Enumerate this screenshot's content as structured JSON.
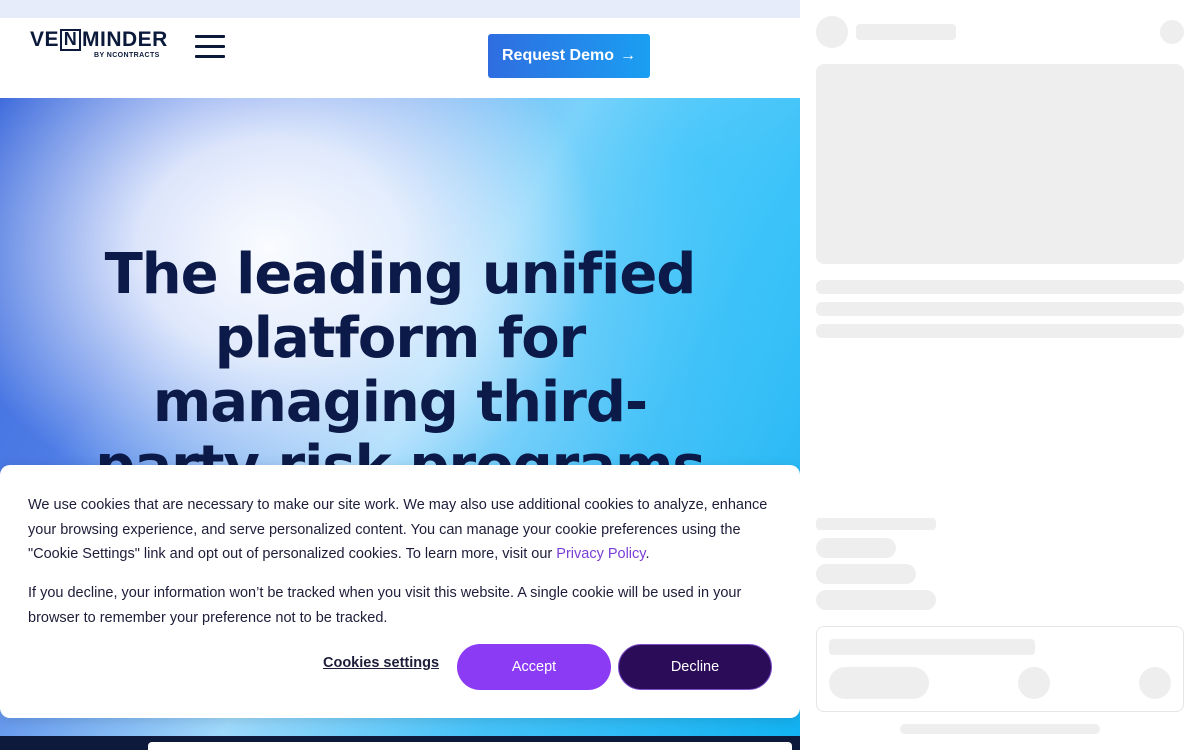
{
  "brand": {
    "logo_prefix": "VE",
    "logo_boxed_letter": "N",
    "logo_suffix": "MINDER",
    "logo_byline": "BY NCONTRACTS"
  },
  "header": {
    "menu_icon": "hamburger-menu-icon",
    "demo_label": "Request Demo",
    "demo_arrow": "→"
  },
  "hero": {
    "title": "The leading unified platform for managing third-party risk programs"
  },
  "cookie_banner": {
    "paragraph1_text": "We use cookies that are necessary to make our site work. We may also use additional cookies to analyze, enhance your browsing experience, and serve personalized content. You can manage your cookie preferences using the \"Cookie Settings\" link and opt out of personalized cookies. To learn more, visit our ",
    "privacy_link": "Privacy Policy",
    "paragraph1_end": ".",
    "paragraph2": "If you decline, your information won’t be tracked when you visit this website. A single cookie will be used in your browser to remember your preference not to be tracked.",
    "settings_label": "Cookies settings",
    "accept_label": "Accept",
    "decline_label": "Decline"
  },
  "colors": {
    "brand_navy": "#0b1a3b",
    "accept_purple": "#8c3bf4",
    "decline_purple": "#2a0c58",
    "link_purple": "#7a3fd6",
    "skeleton_gray": "#eeeeee"
  }
}
